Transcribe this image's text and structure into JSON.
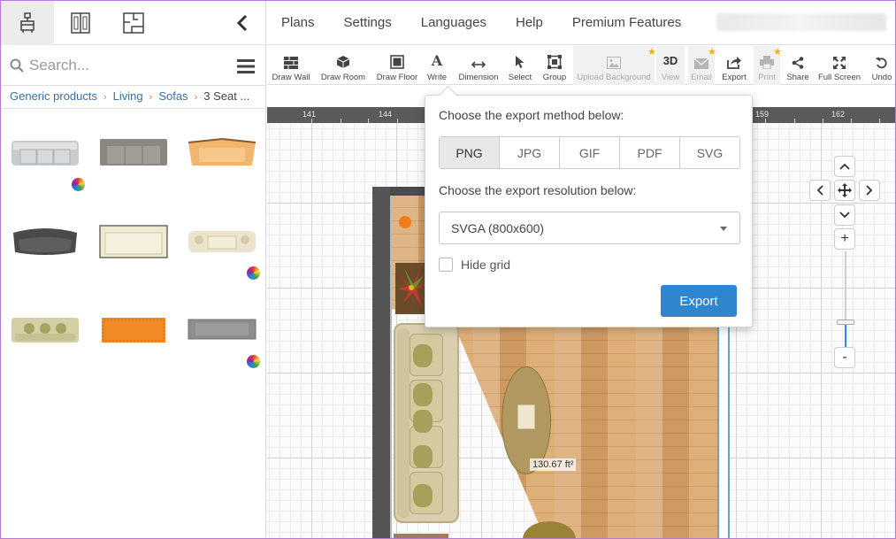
{
  "left_panel": {
    "tabs": [
      {
        "icon": "furniture-icon",
        "active": true
      },
      {
        "icon": "doors-icon",
        "active": false
      },
      {
        "icon": "floorplan-icon",
        "active": false
      }
    ],
    "search_placeholder": "Search...",
    "breadcrumb": [
      "Generic products",
      "Living",
      "Sofas",
      "3 Seat ..."
    ]
  },
  "top_nav": {
    "items": [
      "Plans",
      "Settings",
      "Languages",
      "Help",
      "Premium Features"
    ]
  },
  "toolbar": {
    "tools": [
      {
        "label": "Draw Wall",
        "icon": "wall-icon",
        "disabled": false,
        "premium": false
      },
      {
        "label": "Draw Room",
        "icon": "cube-icon",
        "disabled": false,
        "premium": false
      },
      {
        "label": "Draw Floor",
        "icon": "floor-icon",
        "disabled": false,
        "premium": false
      },
      {
        "label": "Write",
        "icon": "text-icon",
        "disabled": false,
        "premium": false
      },
      {
        "label": "Dimension",
        "icon": "dimension-icon",
        "disabled": false,
        "premium": false
      },
      {
        "label": "Select",
        "icon": "cursor-icon",
        "disabled": false,
        "premium": false
      },
      {
        "label": "Group",
        "icon": "group-icon",
        "disabled": false,
        "premium": false
      },
      {
        "label": "Upload Background",
        "icon": "image-icon",
        "disabled": true,
        "premium": true
      },
      {
        "label": "View",
        "icon": "3d-icon",
        "icon_text": "3D",
        "disabled": true,
        "premium": false
      },
      {
        "label": "Email",
        "icon": "email-icon",
        "disabled": true,
        "premium": true
      },
      {
        "label": "Export",
        "icon": "export-icon",
        "disabled": false,
        "premium": false
      },
      {
        "label": "Print",
        "icon": "print-icon",
        "disabled": true,
        "premium": true
      },
      {
        "label": "Share",
        "icon": "share-icon",
        "disabled": false,
        "premium": false
      },
      {
        "label": "Full Screen",
        "icon": "fullscreen-icon",
        "disabled": false,
        "premium": false
      },
      {
        "label": "Undo",
        "icon": "undo-icon",
        "disabled": false,
        "premium": false
      }
    ]
  },
  "ruler": {
    "ticks": [
      "141",
      "144",
      "159",
      "162"
    ]
  },
  "canvas": {
    "area_label": "130.67 ft²"
  },
  "export_dialog": {
    "method_prompt": "Choose the export method below:",
    "methods": [
      "PNG",
      "JPG",
      "GIF",
      "PDF",
      "SVG"
    ],
    "selected_method": "PNG",
    "resolution_prompt": "Choose the export resolution below:",
    "resolution_value": "SVGA (800x600)",
    "hide_grid_label": "Hide grid",
    "hide_grid_checked": false,
    "export_label": "Export"
  },
  "colors": {
    "accent": "#2f86cf",
    "premium_star": "#f5b400",
    "wall": "#4a4a4a",
    "ruler": "#5a5a5a"
  }
}
